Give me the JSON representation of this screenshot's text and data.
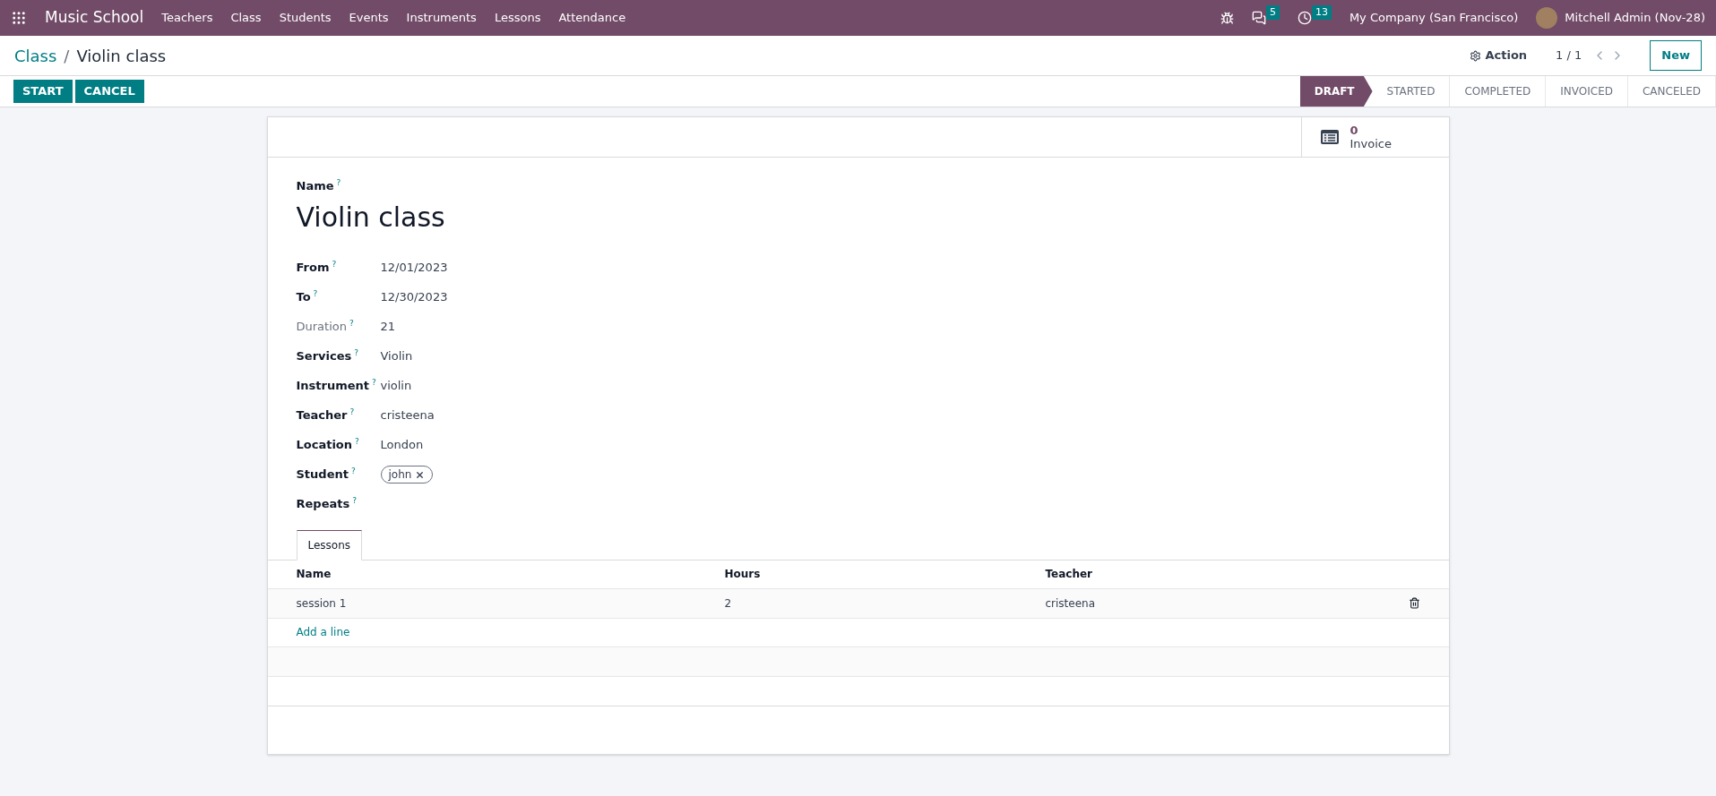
{
  "navbar": {
    "app_name": "Music School",
    "menu": [
      "Teachers",
      "Class",
      "Students",
      "Events",
      "Instruments",
      "Lessons",
      "Attendance"
    ],
    "messages_count": "5",
    "activities_count": "13",
    "company": "My Company (San Francisco)",
    "user": "Mitchell Admin (Nov-28)"
  },
  "breadcrumb": {
    "parent": "Class",
    "separator": "/",
    "current": "Violin class"
  },
  "control_panel": {
    "action": "Action",
    "pager": "1 / 1",
    "new_button": "New"
  },
  "buttons": [
    "START",
    "CANCEL"
  ],
  "statusbar": [
    {
      "label": "DRAFT",
      "selected": true
    },
    {
      "label": "STARTED",
      "selected": false
    },
    {
      "label": "COMPLETED",
      "selected": false
    },
    {
      "label": "INVOICED",
      "selected": false
    },
    {
      "label": "CANCELED",
      "selected": false
    }
  ],
  "stat_button": {
    "value": "0",
    "label": "Invoice"
  },
  "name_field": {
    "label": "Name",
    "help": "?",
    "value": "Violin class"
  },
  "fields": [
    {
      "label": "From",
      "help": "?",
      "value": "12/01/2023",
      "readonly": false
    },
    {
      "label": "To",
      "help": "?",
      "value": "12/30/2023",
      "readonly": false
    },
    {
      "label": "Duration",
      "help": "?",
      "value": "21",
      "readonly": true
    },
    {
      "label": "Services",
      "help": "?",
      "value": "Violin",
      "readonly": false
    },
    {
      "label": "Instrument",
      "help": "?",
      "value": "violin",
      "readonly": false
    },
    {
      "label": "Teacher",
      "help": "?",
      "value": "cristeena",
      "readonly": false
    },
    {
      "label": "Location",
      "help": "?",
      "value": "London",
      "readonly": false
    },
    {
      "label": "Student",
      "help": "?",
      "tags": [
        "john"
      ],
      "readonly": false
    },
    {
      "label": "Repeats",
      "help": "?",
      "readonly": false
    }
  ],
  "tabs": [
    {
      "label": "Lessons",
      "selected": true
    }
  ],
  "table": {
    "columns": [
      "Name",
      "Hours",
      "Teacher"
    ],
    "rows": [
      [
        "session 1",
        "2",
        "cristeena"
      ]
    ],
    "add_line": "Add a line"
  }
}
